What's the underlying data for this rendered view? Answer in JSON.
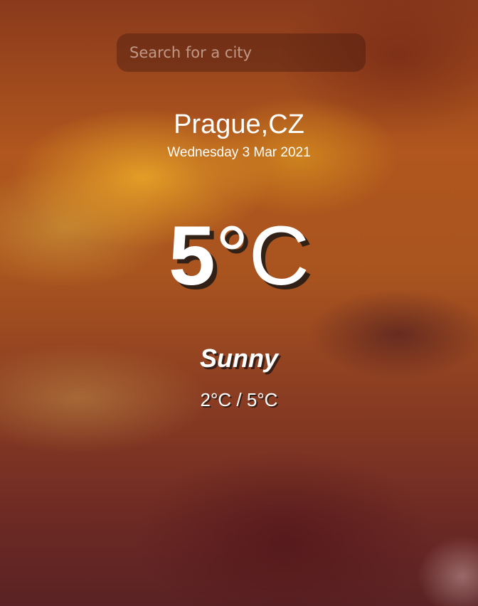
{
  "search": {
    "placeholder": "Search for a city",
    "value": ""
  },
  "location": {
    "city_country": "Prague,CZ",
    "date": "Wednesday 3 Mar 2021"
  },
  "weather": {
    "temperature": "5",
    "unit": "°C",
    "condition": "Sunny",
    "range": "2°C / 5°C"
  },
  "colors": {
    "text": "#ffffff",
    "background_accent": "#b0561e",
    "search_box": "rgba(60,22,12,0.38)"
  }
}
